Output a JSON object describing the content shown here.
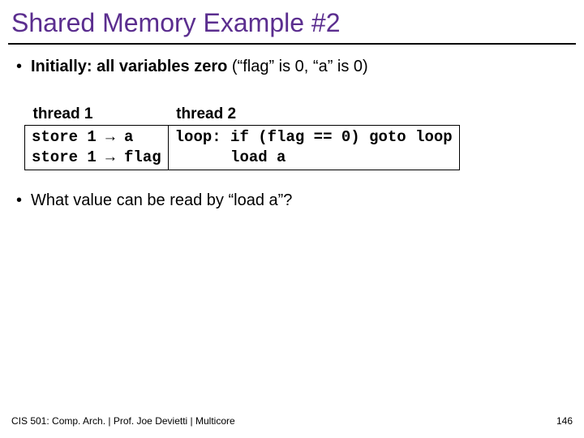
{
  "title": "Shared Memory Example #2",
  "bullet1_bold": "Initially: all variables zero",
  "bullet1_rest": " (“flag” is 0, “a” is 0)",
  "table": {
    "header1": "thread 1",
    "header2": "thread 2",
    "cell1": "store 1 → a\nstore 1 → flag",
    "cell2": "loop: if (flag == 0) goto loop\n      load a"
  },
  "bullet2": "What value can be read by “load a”?",
  "footer_left": "CIS 501: Comp. Arch.  |  Prof. Joe Devietti  |  Multicore",
  "footer_right": "146"
}
